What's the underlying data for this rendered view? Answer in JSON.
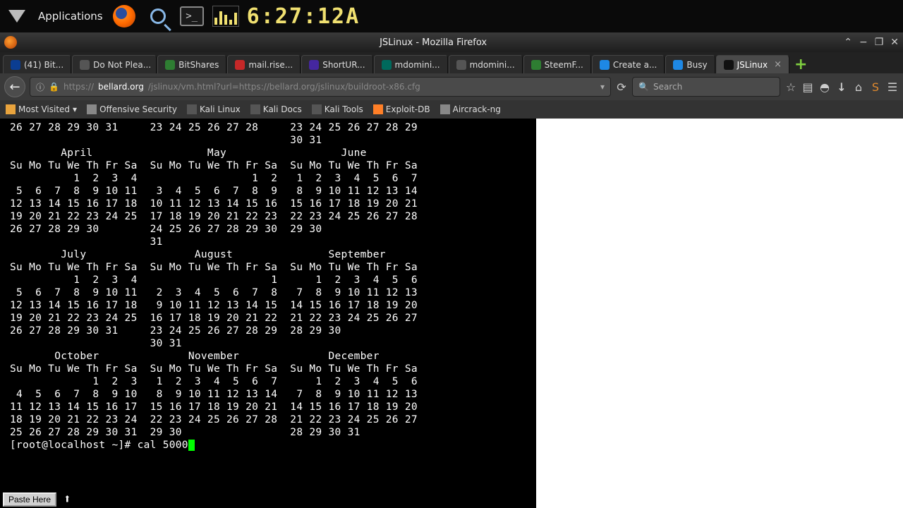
{
  "taskbar": {
    "applications_label": "Applications",
    "clock": "6:27:12A"
  },
  "window": {
    "title": "JSLinux - Mozilla Firefox"
  },
  "tabs": [
    {
      "label": "(41) Bit...",
      "fav": "fav-blue"
    },
    {
      "label": "Do Not Plea...",
      "fav": "fav-grey"
    },
    {
      "label": "BitShares",
      "fav": "fav-green"
    },
    {
      "label": "mail.rise...",
      "fav": "fav-red"
    },
    {
      "label": "ShortUR...",
      "fav": "fav-purp"
    },
    {
      "label": "mdomini...",
      "fav": "fav-steem"
    },
    {
      "label": "mdomini...",
      "fav": "fav-grey"
    },
    {
      "label": "SteemF...",
      "fav": "fav-green"
    },
    {
      "label": "Create a...",
      "fav": "fav-lblue"
    },
    {
      "label": "Busy",
      "fav": "fav-lblue"
    },
    {
      "label": "JSLinux",
      "fav": "fav-black",
      "active": true
    }
  ],
  "nav": {
    "url_prefix": "https://",
    "url_host": "bellard.org",
    "url_path": "/jslinux/vm.html?url=https://bellard.org/jslinux/buildroot-x86.cfg",
    "search_placeholder": "Search"
  },
  "bookmarks": [
    {
      "label": "Most Visited",
      "dropdown": true,
      "color": "#e8a33d"
    },
    {
      "label": "Offensive Security",
      "color": "#888"
    },
    {
      "label": "Kali Linux",
      "color": "#555"
    },
    {
      "label": "Kali Docs",
      "color": "#555"
    },
    {
      "label": "Kali Tools",
      "color": "#555"
    },
    {
      "label": "Exploit-DB",
      "color": "#ff7f27"
    },
    {
      "label": "Aircrack-ng",
      "color": "#888"
    }
  ],
  "terminal": {
    "lines": [
      "26 27 28 29 30 31     23 24 25 26 27 28     23 24 25 26 27 28 29",
      "                                            30 31",
      "        April                  May                  June",
      "Su Mo Tu We Th Fr Sa  Su Mo Tu We Th Fr Sa  Su Mo Tu We Th Fr Sa",
      "          1  2  3  4                  1  2   1  2  3  4  5  6  7",
      " 5  6  7  8  9 10 11   3  4  5  6  7  8  9   8  9 10 11 12 13 14",
      "12 13 14 15 16 17 18  10 11 12 13 14 15 16  15 16 17 18 19 20 21",
      "19 20 21 22 23 24 25  17 18 19 20 21 22 23  22 23 24 25 26 27 28",
      "26 27 28 29 30        24 25 26 27 28 29 30  29 30",
      "                      31",
      "        July                 August               September",
      "Su Mo Tu We Th Fr Sa  Su Mo Tu We Th Fr Sa  Su Mo Tu We Th Fr Sa",
      "          1  2  3  4                     1      1  2  3  4  5  6",
      " 5  6  7  8  9 10 11   2  3  4  5  6  7  8   7  8  9 10 11 12 13",
      "12 13 14 15 16 17 18   9 10 11 12 13 14 15  14 15 16 17 18 19 20",
      "19 20 21 22 23 24 25  16 17 18 19 20 21 22  21 22 23 24 25 26 27",
      "26 27 28 29 30 31     23 24 25 26 27 28 29  28 29 30",
      "                      30 31",
      "       October              November              December",
      "Su Mo Tu We Th Fr Sa  Su Mo Tu We Th Fr Sa  Su Mo Tu We Th Fr Sa",
      "             1  2  3   1  2  3  4  5  6  7      1  2  3  4  5  6",
      " 4  5  6  7  8  9 10   8  9 10 11 12 13 14   7  8  9 10 11 12 13",
      "11 12 13 14 15 16 17  15 16 17 18 19 20 21  14 15 16 17 18 19 20",
      "18 19 20 21 22 23 24  22 23 24 25 26 27 28  21 22 23 24 25 26 27",
      "25 26 27 28 29 30 31  29 30                 28 29 30 31",
      "",
      "[root@localhost ~]# cal 5000"
    ],
    "paste_label": "Paste Here"
  }
}
